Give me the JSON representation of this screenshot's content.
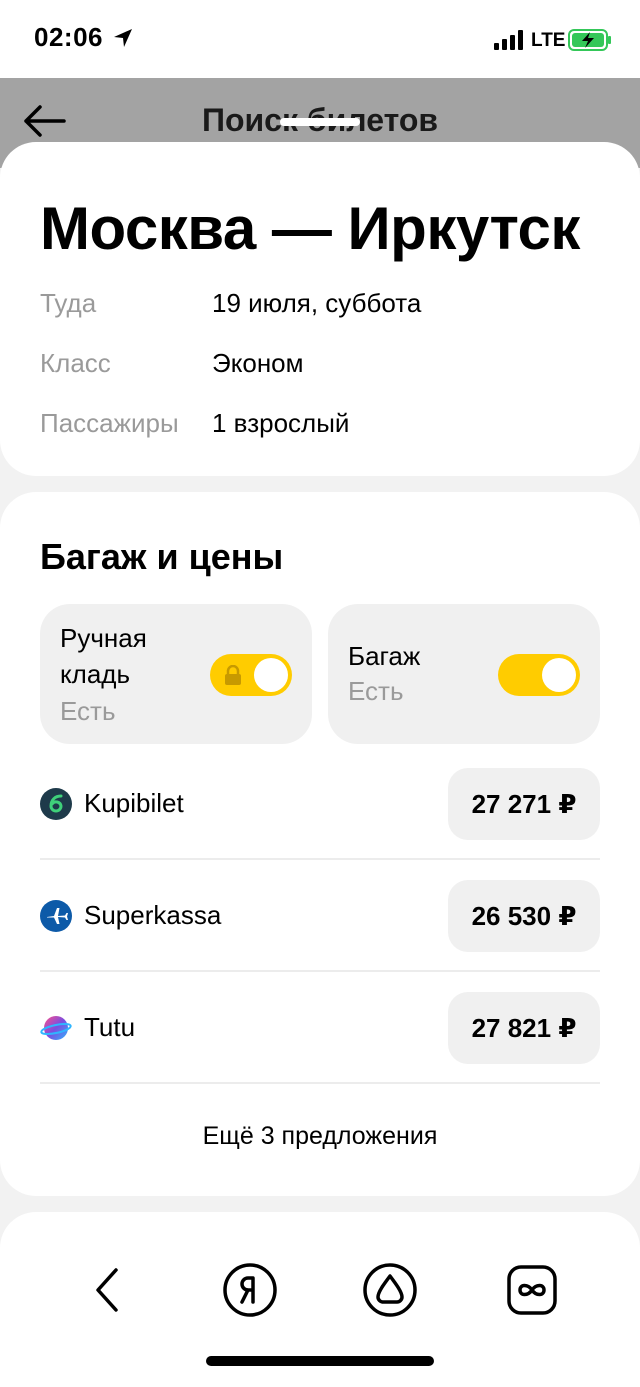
{
  "status_bar": {
    "time": "02:06",
    "network": "LTE",
    "battery_color": "#34c759"
  },
  "header": {
    "title": "Поиск билетов",
    "back_icon": "arrow-left-icon"
  },
  "route": {
    "title": "Москва — Иркутск",
    "rows": [
      {
        "label": "Туда",
        "value": "19 июля, суббота"
      },
      {
        "label": "Класс",
        "value": "Эконом"
      },
      {
        "label": "Пассажиры",
        "value": "1 взрослый"
      }
    ]
  },
  "baggage": {
    "title": "Багаж и цены",
    "hand_luggage": {
      "label_line1": "Ручная",
      "label_line2": "кладь",
      "status": "Есть",
      "on": true,
      "locked": true
    },
    "luggage": {
      "label": "Багаж",
      "status": "Есть",
      "on": true
    },
    "accent_color": "#ffcc00"
  },
  "offers": [
    {
      "name": "Kupibilet",
      "price": "27 271 ₽",
      "icon": "kupibilet-logo-icon",
      "color": "#1e3a4a"
    },
    {
      "name": "Superkassa",
      "price": "26 530 ₽",
      "icon": "plane-logo-icon",
      "color": "#0d5aa8"
    },
    {
      "name": "Tutu",
      "price": "27 821 ₽",
      "icon": "tutu-logo-icon",
      "color": "#7a4de0"
    }
  ],
  "more_offers": "Ещё 3 предложения",
  "toolbar": {
    "items": [
      "back-chevron-icon",
      "yandex-logo-icon",
      "alice-icon",
      "infinity-icon"
    ]
  }
}
